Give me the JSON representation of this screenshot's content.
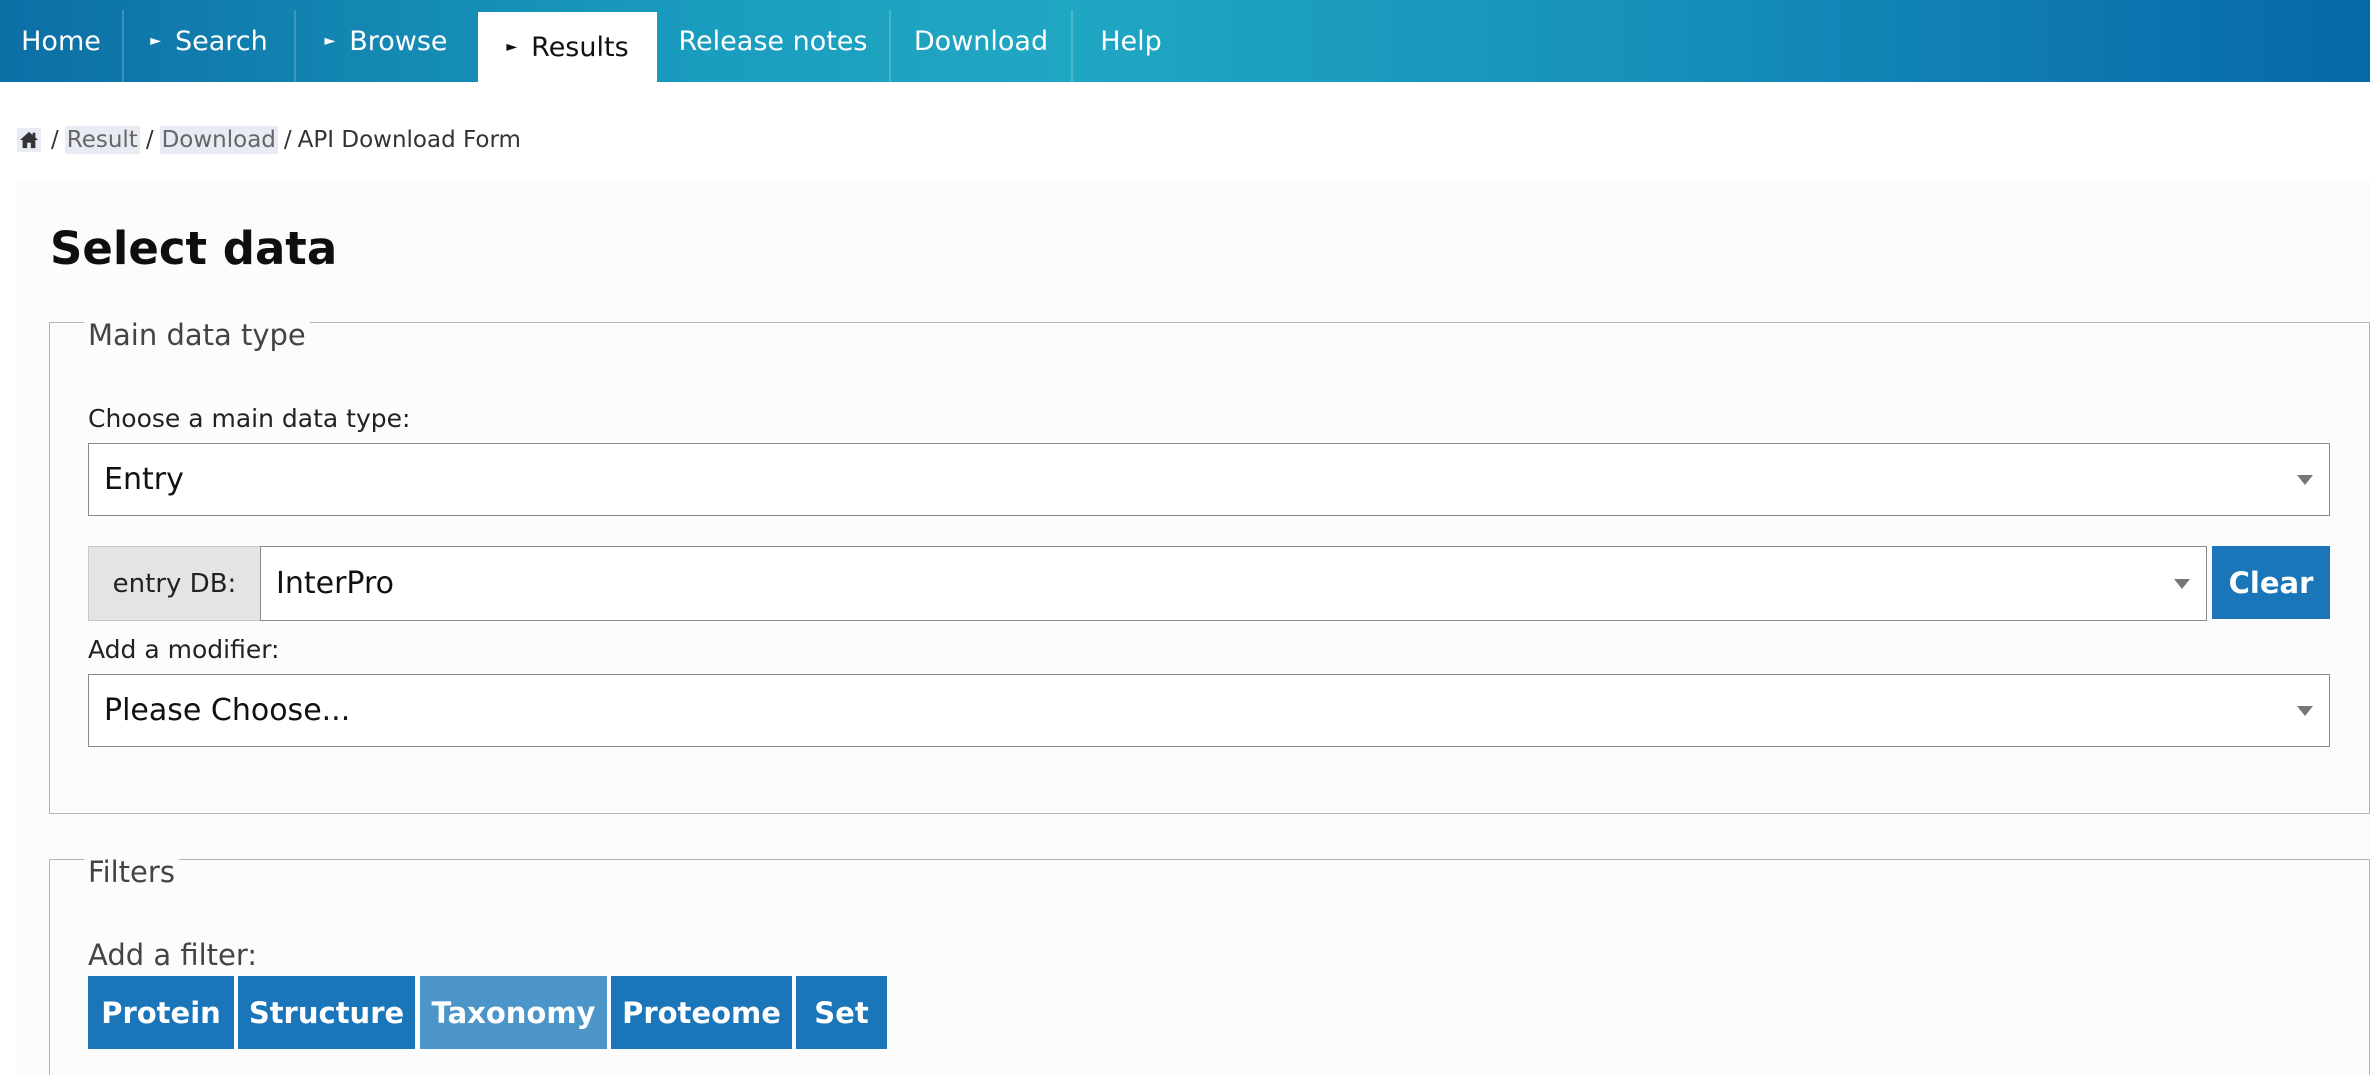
{
  "nav": {
    "tabs": [
      {
        "label": "Home"
      },
      {
        "label": "Search"
      },
      {
        "label": "Browse"
      },
      {
        "label": "Results"
      },
      {
        "label": "Release notes"
      },
      {
        "label": "Download"
      },
      {
        "label": "Help"
      }
    ],
    "active_tab": "Results"
  },
  "breadcrumb": {
    "home_icon": "home-icon",
    "items": [
      "Result",
      "Download"
    ],
    "current": "API Download Form"
  },
  "page_title": "Select data",
  "main_data_type": {
    "legend": "Main data type",
    "choose_label": "Choose a main data type:",
    "selected": "Entry",
    "entry_db_label": "entry DB:",
    "entry_db_value": "InterPro",
    "clear_label": "Clear",
    "modifier_label": "Add a modifier:",
    "modifier_value": "Please Choose..."
  },
  "filters": {
    "legend": "Filters",
    "add_label": "Add a filter:",
    "buttons": [
      "Protein",
      "Structure",
      "Taxonomy",
      "Proteome",
      "Set"
    ]
  },
  "colors": {
    "nav_gradient": [
      "#0c6fa5",
      "#20a7c2",
      "#0767a8"
    ],
    "button": "#1a76b8",
    "button_faded": "#4b95c8"
  }
}
